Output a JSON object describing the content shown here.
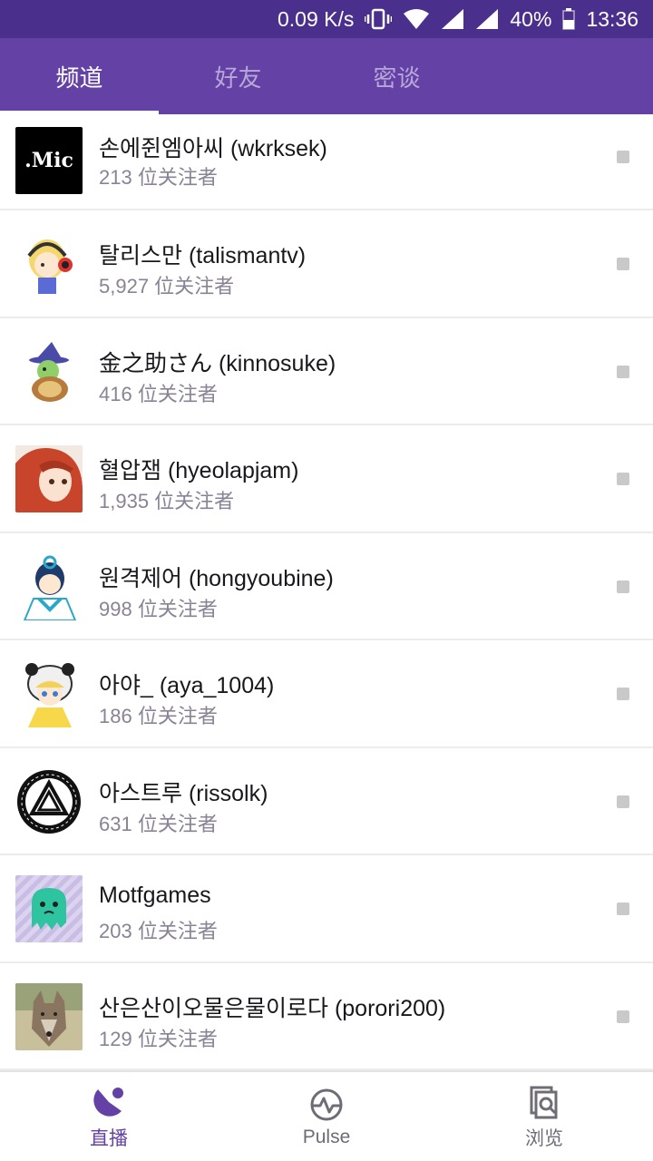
{
  "status_bar": {
    "speed": "0.09 K/s",
    "battery": "40%",
    "time": "13:36"
  },
  "tabs": [
    {
      "label": "频道",
      "active": true
    },
    {
      "label": "好友",
      "active": false
    },
    {
      "label": "密谈",
      "active": false
    }
  ],
  "channels": [
    {
      "name": "손에쥔엠아씨 (wkrksek)",
      "followers": "213 位关注者",
      "avatar_icon": "mic-logo-icon",
      "avatar_text": ".Mic"
    },
    {
      "name": "탈리스만 (talismantv)",
      "followers": "5,927 位关注者",
      "avatar_icon": "blonde-headphones-avatar-icon"
    },
    {
      "name": "金之助さん (kinnosuke)",
      "followers": "416 位关注者",
      "avatar_icon": "turtle-wizard-avatar-icon"
    },
    {
      "name": "혈압잼 (hyeolapjam)",
      "followers": "1,935 位关注者",
      "avatar_icon": "red-hair-girl-avatar-icon"
    },
    {
      "name": "원격제어 (hongyoubine)",
      "followers": "998 位关注者",
      "avatar_icon": "sailor-boy-avatar-icon"
    },
    {
      "name": "아야_ (aya_1004)",
      "followers": "186 位关注者",
      "avatar_icon": "panda-hood-girl-avatar-icon"
    },
    {
      "name": "아스트루 (rissolk)",
      "followers": "631 位关注者",
      "avatar_icon": "rune-circle-avatar-icon"
    },
    {
      "name": "Motfgames",
      "followers": "203 位关注者",
      "avatar_icon": "green-slime-avatar-icon"
    },
    {
      "name": "산은산이오물은물이로다 (porori200)",
      "followers": "129 位关注者",
      "avatar_icon": "wolf-photo-avatar-icon"
    }
  ],
  "bottom_nav": [
    {
      "label": "直播",
      "icon": "live-icon",
      "active": true
    },
    {
      "label": "Pulse",
      "icon": "pulse-icon",
      "active": false
    },
    {
      "label": "浏览",
      "icon": "browse-icon",
      "active": false
    }
  ],
  "colors": {
    "brand": "#6441a5",
    "status_bar": "#4b2f8c",
    "unread_dot": "#c9c9c9"
  }
}
